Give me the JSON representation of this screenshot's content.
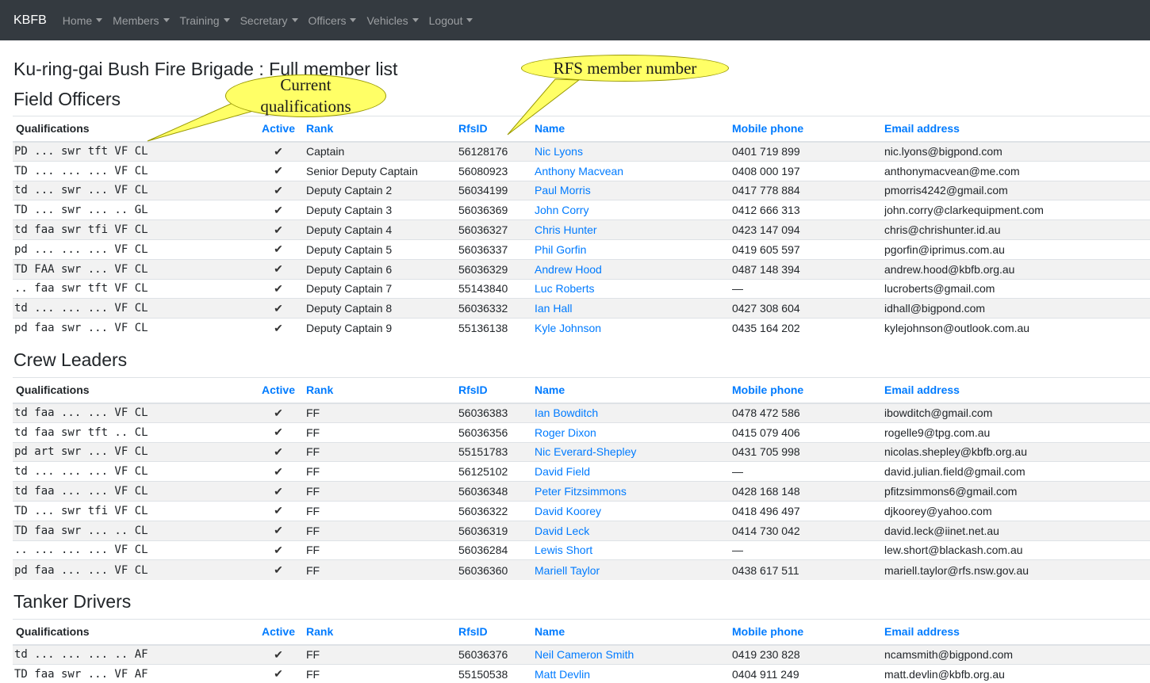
{
  "nav": {
    "brand": "KBFB",
    "items": [
      {
        "label": "Home"
      },
      {
        "label": "Members"
      },
      {
        "label": "Training"
      },
      {
        "label": "Secretary"
      },
      {
        "label": "Officers"
      },
      {
        "label": "Vehicles"
      },
      {
        "label": "Logout"
      }
    ]
  },
  "page_title": "Ku-ring-gai Bush Fire Brigade : Full member list",
  "annotations": {
    "rfs": "RFS member number",
    "quals_line1": "Current",
    "quals_line2": "qualifications"
  },
  "columns": [
    "Qualifications",
    "Active",
    "Rank",
    "RfsID",
    "Name",
    "Mobile phone",
    "Email address"
  ],
  "sections": [
    {
      "title": "Field Officers",
      "rows": [
        {
          "q": "PD ... swr tft VF CL",
          "active": "✔",
          "rank": "Captain",
          "id": "56128176",
          "name": "Nic Lyons",
          "phone": "0401 719 899",
          "email": "nic.lyons@bigpond.com"
        },
        {
          "q": "TD ... ... ... VF CL",
          "active": "✔",
          "rank": "Senior Deputy Captain",
          "id": "56080923",
          "name": "Anthony Macvean",
          "phone": "0408 000 197",
          "email": "anthonymacvean@me.com"
        },
        {
          "q": "td ... swr ... VF CL",
          "active": "✔",
          "rank": "Deputy Captain 2",
          "id": "56034199",
          "name": "Paul Morris",
          "phone": "0417 778 884",
          "email": "pmorris4242@gmail.com"
        },
        {
          "q": "TD ... swr ... .. GL",
          "active": "✔",
          "rank": "Deputy Captain 3",
          "id": "56036369",
          "name": "John Corry",
          "phone": "0412 666 313",
          "email": "john.corry@clarkequipment.com"
        },
        {
          "q": "td faa swr tfi VF CL",
          "active": "✔",
          "rank": "Deputy Captain 4",
          "id": "56036327",
          "name": "Chris Hunter",
          "phone": "0423 147 094",
          "email": "chris@chrishunter.id.au"
        },
        {
          "q": "pd ... ... ... VF CL",
          "active": "✔",
          "rank": "Deputy Captain 5",
          "id": "56036337",
          "name": "Phil Gorfin",
          "phone": "0419 605 597",
          "email": "pgorfin@iprimus.com.au"
        },
        {
          "q": "TD FAA swr ... VF CL",
          "active": "✔",
          "rank": "Deputy Captain 6",
          "id": "56036329",
          "name": "Andrew Hood",
          "phone": "0487 148 394",
          "email": "andrew.hood@kbfb.org.au"
        },
        {
          "q": ".. faa swr tft VF CL",
          "active": "✔",
          "rank": "Deputy Captain 7",
          "id": "55143840",
          "name": "Luc Roberts",
          "phone": "—",
          "email": "lucroberts@gmail.com"
        },
        {
          "q": "td ... ... ... VF CL",
          "active": "✔",
          "rank": "Deputy Captain 8",
          "id": "56036332",
          "name": "Ian Hall",
          "phone": "0427 308 604",
          "email": "idhall@bigpond.com"
        },
        {
          "q": "pd faa swr ... VF CL",
          "active": "✔",
          "rank": "Deputy Captain 9",
          "id": "55136138",
          "name": "Kyle Johnson",
          "phone": "0435 164 202",
          "email": "kylejohnson@outlook.com.au"
        }
      ]
    },
    {
      "title": "Crew Leaders",
      "rows": [
        {
          "q": "td faa ... ... VF CL",
          "active": "✔",
          "rank": "FF",
          "id": "56036383",
          "name": "Ian Bowditch",
          "phone": "0478 472 586",
          "email": "ibowditch@gmail.com"
        },
        {
          "q": "td faa swr tft .. CL",
          "active": "✔",
          "rank": "FF",
          "id": "56036356",
          "name": "Roger Dixon",
          "phone": "0415 079 406",
          "email": "rogelle9@tpg.com.au"
        },
        {
          "q": "pd art swr ... VF CL",
          "active": "✔",
          "rank": "FF",
          "id": "55151783",
          "name": "Nic Everard-Shepley",
          "phone": "0431 705 998",
          "email": "nicolas.shepley@kbfb.org.au"
        },
        {
          "q": "td ... ... ... VF CL",
          "active": "✔",
          "rank": "FF",
          "id": "56125102",
          "name": "David Field",
          "phone": "—",
          "email": "david.julian.field@gmail.com"
        },
        {
          "q": "td faa ... ... VF CL",
          "active": "✔",
          "rank": "FF",
          "id": "56036348",
          "name": "Peter Fitzsimmons",
          "phone": "0428 168 148",
          "email": "pfitzsimmons6@gmail.com"
        },
        {
          "q": "TD ... swr tfi VF CL",
          "active": "✔",
          "rank": "FF",
          "id": "56036322",
          "name": "David Koorey",
          "phone": "0418 496 497",
          "email": "djkoorey@yahoo.com"
        },
        {
          "q": "TD faa swr ... .. CL",
          "active": "✔",
          "rank": "FF",
          "id": "56036319",
          "name": "David Leck",
          "phone": "0414 730 042",
          "email": "david.leck@iinet.net.au"
        },
        {
          "q": ".. ... ... ... VF CL",
          "active": "✔",
          "rank": "FF",
          "id": "56036284",
          "name": "Lewis Short",
          "phone": "—",
          "email": "lew.short@blackash.com.au"
        },
        {
          "q": "pd faa ... ... VF CL",
          "active": "✔",
          "rank": "FF",
          "id": "56036360",
          "name": "Mariell Taylor",
          "phone": "0438 617 511",
          "email": "mariell.taylor@rfs.nsw.gov.au"
        }
      ]
    },
    {
      "title": "Tanker Drivers",
      "rows": [
        {
          "q": "td ... ... ... .. AF",
          "active": "✔",
          "rank": "FF",
          "id": "56036376",
          "name": "Neil Cameron Smith",
          "phone": "0419 230 828",
          "email": "ncamsmith@bigpond.com"
        },
        {
          "q": "TD faa swr ... VF AF",
          "active": "✔",
          "rank": "FF",
          "id": "55150538",
          "name": "Matt Devlin",
          "phone": "0404 911 249",
          "email": "matt.devlin@kbfb.org.au"
        }
      ]
    }
  ]
}
